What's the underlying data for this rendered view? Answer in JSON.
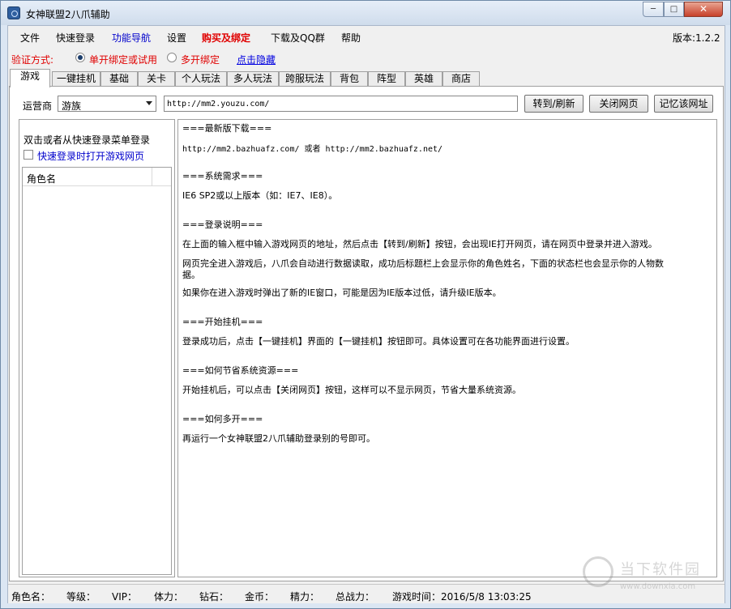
{
  "window": {
    "title": "女神联盟2八爪辅助",
    "min": "─",
    "max": "□",
    "close": "✕"
  },
  "menu": [
    {
      "label": "文件",
      "color": "#000000"
    },
    {
      "label": "快速登录",
      "color": "#000000"
    },
    {
      "label": "功能导航",
      "color": "#0000cc"
    },
    {
      "label": "设置",
      "color": "#000000"
    },
    {
      "label": "购买及绑定",
      "color": "#e00000"
    },
    {
      "label": "下载及QQ群",
      "color": "#000000"
    },
    {
      "label": "帮助",
      "color": "#000000"
    }
  ],
  "version": "版本:1.2.2",
  "verify": {
    "label": "验证方式:",
    "option1": "单开绑定或试用",
    "option2": "多开绑定",
    "link": "点击隐藏"
  },
  "tabs": [
    "游戏",
    "一键挂机",
    "基础",
    "关卡",
    "个人玩法",
    "多人玩法",
    "跨服玩法",
    "背包",
    "阵型",
    "英雄",
    "商店"
  ],
  "toolbar": {
    "operator_label": "运营商",
    "operator_value": "游族",
    "url": "http://mm2.youzu.com/",
    "goto_button": "转到/刷新",
    "close_button": "关闭网页",
    "remember_button": "记忆该网址"
  },
  "left": {
    "hint": "双击或者从快速登录菜单登录",
    "checkbox_label": "快速登录时打开游戏网页",
    "list_header": "角色名"
  },
  "content": [
    {
      "text": "===最新版下载===",
      "mono": false
    },
    {
      "text": "http://mm2.bazhuafz.com/ 或者 http://mm2.bazhuafz.net/",
      "mono": true
    },
    {
      "text": "===系统需求===",
      "mono": false
    },
    {
      "text": "IE6 SP2或以上版本（如：IE7、IE8）。",
      "mono": false
    },
    {
      "text": "===登录说明===",
      "mono": false
    },
    {
      "text": "在上面的输入框中输入游戏网页的地址，然后点击【转到/刷新】按钮，会出现IE打开网页，请在网页中登录并进入游戏。",
      "mono": false
    },
    {
      "text": "网页完全进入游戏后，八爪会自动进行数据读取，成功后标题栏上会显示你的角色姓名，下面的状态栏也会显示你的人物数",
      "mono": false
    },
    {
      "text": "据。",
      "mono": false
    },
    {
      "text": "如果你在进入游戏时弹出了新的IE窗口，可能是因为IE版本过低，请升级IE版本。",
      "mono": false
    },
    {
      "text": "===开始挂机===",
      "mono": false
    },
    {
      "text": "登录成功后，点击【一键挂机】界面的【一键挂机】按钮即可。具体设置可在各功能界面进行设置。",
      "mono": false
    },
    {
      "text": "===如何节省系统资源===",
      "mono": false
    },
    {
      "text": "开始挂机后，可以点击【关闭网页】按钮，这样可以不显示网页，节省大量系统资源。",
      "mono": false
    },
    {
      "text": "===如何多开===",
      "mono": false
    },
    {
      "text": "再运行一个女神联盟2八爪辅助登录别的号即可。",
      "mono": false
    }
  ],
  "status": [
    "角色名：",
    "等级：",
    "VIP：",
    "体力：",
    "钻石：",
    "金币：",
    "精力：",
    "总战力：",
    "游戏时间：2016/5/8 13:03:25"
  ],
  "watermark": {
    "text": "当下软件园",
    "sub": "www.downxia.com"
  }
}
